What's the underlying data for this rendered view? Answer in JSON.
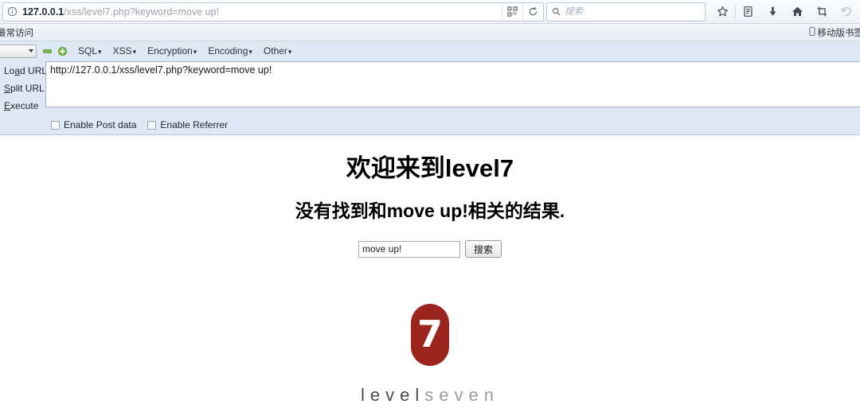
{
  "browser": {
    "url_host": "127.0.0.1",
    "url_path": "/xss/level7.php?keyword=move up!",
    "identity_icon": "info-circle-icon",
    "qr_icon": "qr-code-icon",
    "reload_icon": "reload-icon",
    "search_placeholder": "搜索",
    "search_icon": "magnifier-icon",
    "toolbar_icons": [
      {
        "name": "bookmark-star-icon",
        "glyph": "star"
      },
      {
        "name": "library-icon",
        "glyph": "library"
      },
      {
        "name": "downloads-icon",
        "glyph": "download"
      },
      {
        "name": "home-icon",
        "glyph": "home"
      },
      {
        "name": "screenshot-icon",
        "glyph": "crop"
      },
      {
        "name": "undo-close-tab-icon",
        "glyph": "undo"
      }
    ],
    "bookmarks": {
      "most_visited": "最常访问",
      "mobile_bookmarks": "移动版书签",
      "mobile_icon": "mobile-phone-icon"
    }
  },
  "hackbar": {
    "select_value": "",
    "remove_icon": "green-minus-icon",
    "add_icon": "green-plus-icon",
    "menus": [
      {
        "label": "SQL",
        "caret": "▾"
      },
      {
        "label": "XSS",
        "caret": "▾"
      },
      {
        "label": "Encryption",
        "caret": "▾"
      },
      {
        "label": "Encoding",
        "caret": "▾"
      },
      {
        "label": "Other",
        "caret": "▾"
      }
    ],
    "buttons": [
      {
        "name": "load-url-button",
        "pre": "Lo",
        "key": "a",
        "post": "d URL"
      },
      {
        "name": "split-url-button",
        "pre": "",
        "key": "S",
        "post": "plit URL"
      },
      {
        "name": "execute-button",
        "pre": "",
        "key": "E",
        "post": "xecute"
      }
    ],
    "url_value": "http://127.0.0.1/xss/level7.php?keyword=move up!",
    "checkboxes": [
      {
        "name": "enable-post-data-checkbox",
        "label": "Enable Post data",
        "checked": false
      },
      {
        "name": "enable-referrer-checkbox",
        "label": "Enable Referrer",
        "checked": false
      }
    ]
  },
  "page": {
    "heading": "欢迎来到level7",
    "subheading": "没有找到和move up!相关的结果.",
    "search": {
      "input_value": "move up!",
      "input_placeholder": "",
      "submit_label": "搜索"
    },
    "logo": {
      "number": "7",
      "word_bold": "level",
      "word_light": "seven",
      "pill_color": "#9c241e"
    }
  }
}
